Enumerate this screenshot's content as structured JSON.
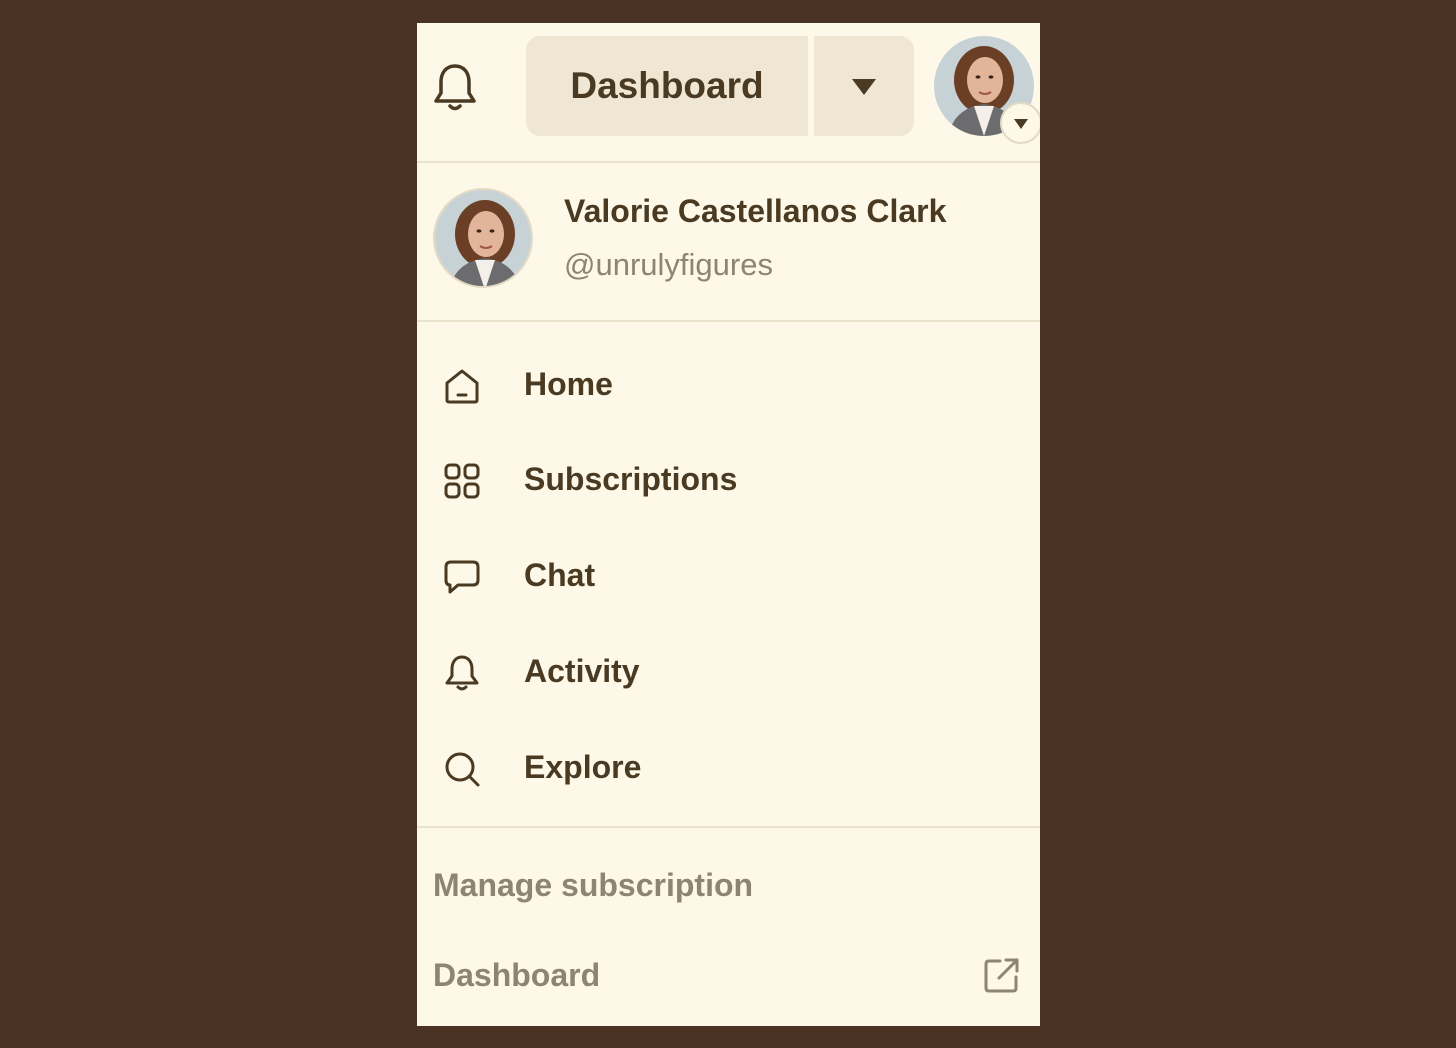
{
  "header": {
    "dashboard_label": "Dashboard"
  },
  "profile": {
    "name": "Valorie Castellanos Clark",
    "handle": "@unrulyfigures"
  },
  "nav": {
    "items": [
      {
        "label": "Home",
        "icon": "home-icon"
      },
      {
        "label": "Subscriptions",
        "icon": "grid-icon"
      },
      {
        "label": "Chat",
        "icon": "chat-bubble-icon"
      },
      {
        "label": "Activity",
        "icon": "bell-icon"
      },
      {
        "label": "Explore",
        "icon": "search-icon"
      }
    ]
  },
  "footer": {
    "manage_subscription": "Manage subscription",
    "dashboard": "Dashboard"
  },
  "colors": {
    "background": "#4a3322",
    "panel": "#fdf8e8",
    "text": "#4a3a22",
    "muted": "#8e8472",
    "button": "#efe7d4"
  }
}
